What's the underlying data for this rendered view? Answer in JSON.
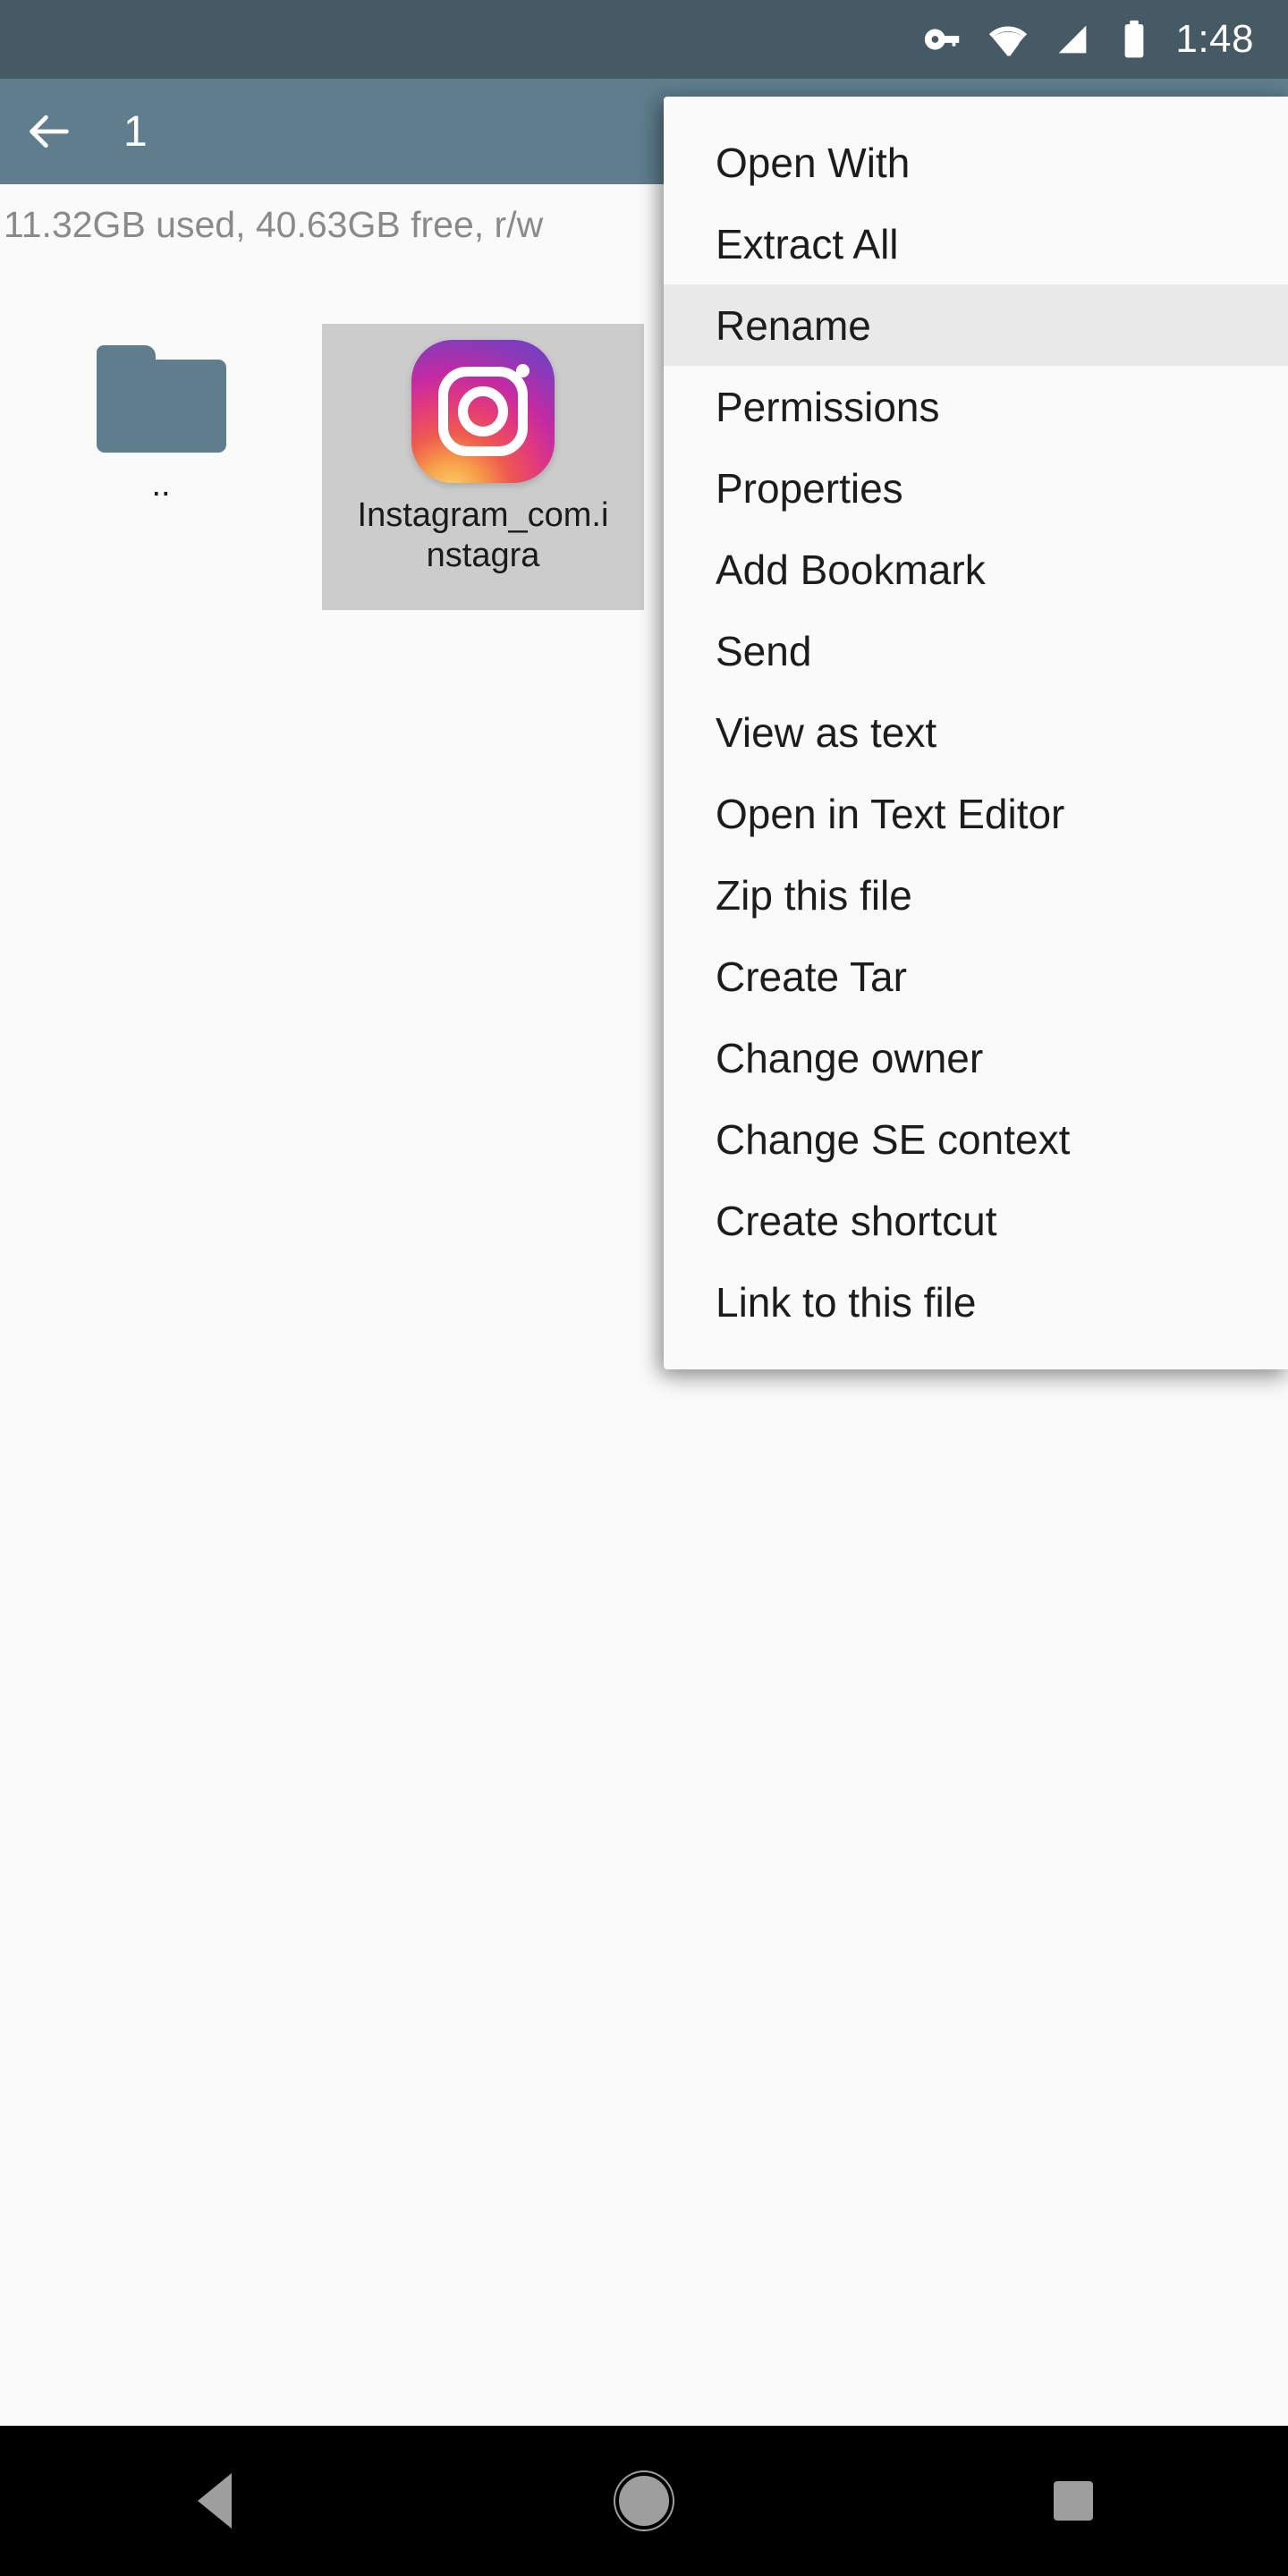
{
  "status_bar": {
    "background": "#455A64",
    "time": "1:48",
    "icons": [
      "vpn-key-icon",
      "wifi-icon",
      "cell-signal-icon",
      "battery-icon"
    ]
  },
  "toolbar": {
    "background": "#5F7D8C",
    "back_icon": "arrow-back-icon",
    "title": "1",
    "copy_icon": "copy-icon"
  },
  "storage": {
    "text": "11.32GB used, 40.63GB free, r/w"
  },
  "files": {
    "items": [
      {
        "label": "..",
        "icon": "folder-icon",
        "selected": false
      },
      {
        "label": "Instagram_com.instagra",
        "icon": "instagram-icon",
        "selected": true
      }
    ]
  },
  "context_menu": {
    "background": "#fafafa",
    "highlight_color": "#e9e9e9",
    "highlighted_index": 2,
    "items": [
      {
        "label": "Open With"
      },
      {
        "label": "Extract All"
      },
      {
        "label": "Rename"
      },
      {
        "label": "Permissions"
      },
      {
        "label": "Properties"
      },
      {
        "label": "Add Bookmark"
      },
      {
        "label": "Send"
      },
      {
        "label": "View as text"
      },
      {
        "label": "Open in Text Editor"
      },
      {
        "label": "Zip this file"
      },
      {
        "label": "Create Tar"
      },
      {
        "label": "Change owner"
      },
      {
        "label": "Change SE context"
      },
      {
        "label": "Create shortcut"
      },
      {
        "label": "Link to this file"
      }
    ]
  },
  "nav_bar": {
    "background": "#000000",
    "buttons": [
      {
        "name": "back",
        "icon": "nav-back-triangle-icon"
      },
      {
        "name": "home",
        "icon": "nav-home-circle-icon"
      },
      {
        "name": "recents",
        "icon": "nav-recents-square-icon"
      }
    ]
  }
}
